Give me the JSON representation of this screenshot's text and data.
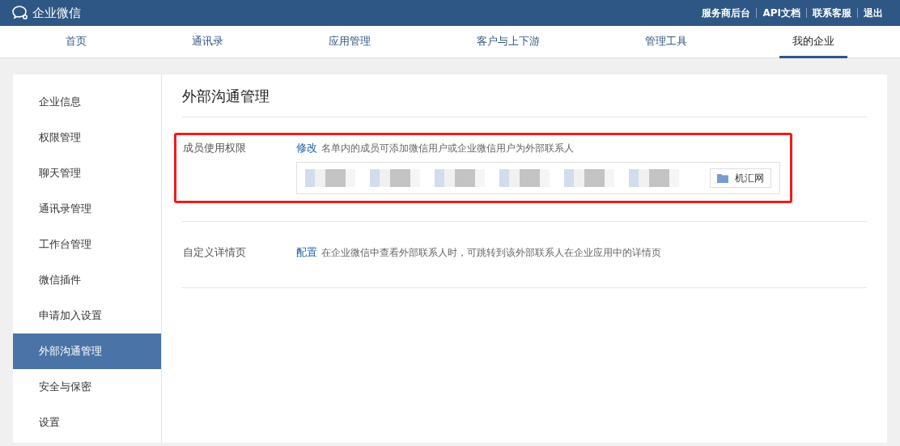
{
  "header": {
    "logo_text": "企业微信",
    "links": [
      "服务商后台",
      "API文档",
      "联系客服",
      "退出"
    ]
  },
  "nav_tabs": [
    {
      "label": "首页",
      "selected": false
    },
    {
      "label": "通讯录",
      "selected": false
    },
    {
      "label": "应用管理",
      "selected": false
    },
    {
      "label": "客户与上下游",
      "selected": false
    },
    {
      "label": "管理工具",
      "selected": false
    },
    {
      "label": "我的企业",
      "selected": true
    }
  ],
  "sidebar": {
    "items": [
      {
        "label": "企业信息",
        "selected": false
      },
      {
        "label": "权限管理",
        "selected": false
      },
      {
        "label": "聊天管理",
        "selected": false
      },
      {
        "label": "通讯录管理",
        "selected": false
      },
      {
        "label": "工作台管理",
        "selected": false
      },
      {
        "label": "微信插件",
        "selected": false
      },
      {
        "label": "申请加入设置",
        "selected": false
      },
      {
        "label": "外部沟通管理",
        "selected": true
      },
      {
        "label": "安全与保密",
        "selected": false
      },
      {
        "label": "设置",
        "selected": false
      }
    ]
  },
  "page_title": "外部沟通管理",
  "sections": [
    {
      "label": "成员使用权限",
      "action": "修改",
      "description": "名单内的成员可添加微信用户或企业微信用户为外部联系人",
      "highlighted": true,
      "members": [
        {
          "kind": "blurred"
        },
        {
          "kind": "blurred"
        },
        {
          "kind": "blurred"
        },
        {
          "kind": "blurred"
        },
        {
          "kind": "blurred"
        },
        {
          "kind": "blurred"
        },
        {
          "kind": "department",
          "label": "机汇网"
        }
      ]
    },
    {
      "label": "自定义详情页",
      "action": "配置",
      "description": "在企业微信中查看外部联系人时，可跳转到该外部联系人在企业应用中的详情页",
      "highlighted": false
    }
  ]
}
